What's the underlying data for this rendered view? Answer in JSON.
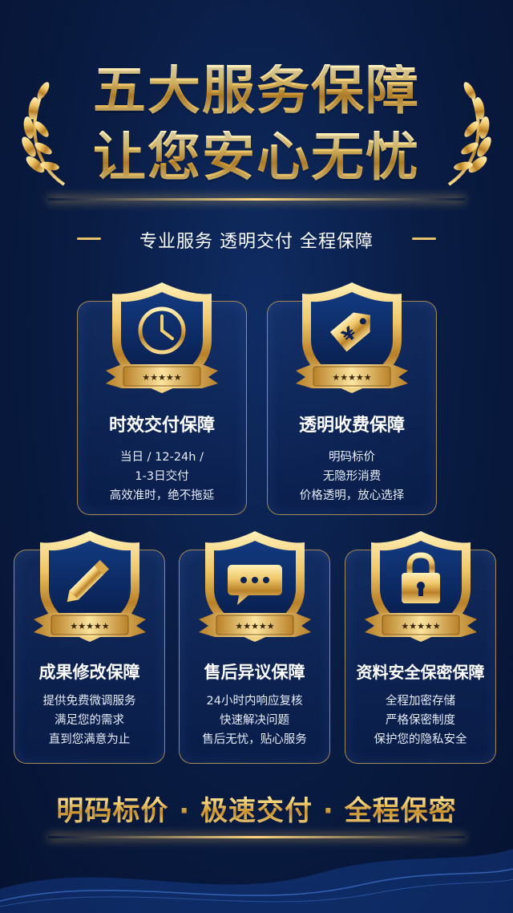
{
  "header": {
    "title_line1": "五大服务保障",
    "title_line2": "让您安心无忧",
    "subtitle": "专业服务 透明交付 全程保障"
  },
  "cards": [
    {
      "icon": "clock-icon",
      "title": "时效交付保障",
      "lines": [
        "当日 / 12-24h /",
        "1-3日交付",
        "高效准时，绝不拖延"
      ]
    },
    {
      "icon": "price-tag-icon",
      "title": "透明收费保障",
      "lines": [
        "明码标价",
        "无隐形消费",
        "价格透明，放心选择"
      ]
    },
    {
      "icon": "pencil-icon",
      "title": "成果修改保障",
      "lines": [
        "提供免费微调服务",
        "满足您的需求",
        "直到您满意为止"
      ]
    },
    {
      "icon": "chat-bubble-icon",
      "title": "售后异议保障",
      "lines": [
        "24小时内响应复核",
        "快速解决问题",
        "售后无忧，贴心服务"
      ]
    },
    {
      "icon": "lock-icon",
      "title": "资料安全保密保障",
      "lines": [
        "全程加密存储",
        "严格保密制度",
        "保护您的隐私安全"
      ]
    }
  ],
  "footer": {
    "slogan": "明码标价 · 极速交付 · 全程保密"
  },
  "colors": {
    "background": "#0a1d45",
    "gold": "#f3cf72",
    "gold_dark": "#c9902f"
  }
}
